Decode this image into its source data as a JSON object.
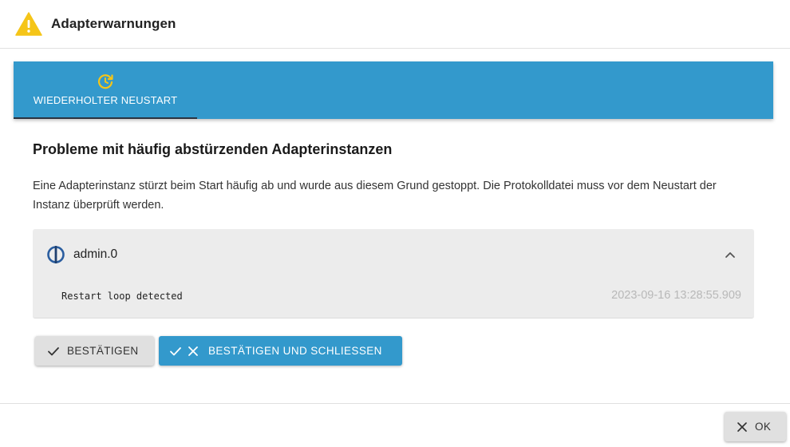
{
  "dialog": {
    "title": "Adapterwarnungen",
    "header_icon": "warning-triangle-icon",
    "accent_color": "#3399cc",
    "warning_color": "#f5c518"
  },
  "tabs": [
    {
      "label": "WIEDERHOLTER NEUSTART",
      "icon": "restart-clock-icon",
      "selected": true
    }
  ],
  "section": {
    "title": "Probleme mit häufig abstürzenden Adapterinstanzen",
    "description": "Eine Adapterinstanz stürzt beim Start häufig ab und wurde aus diesem Grund gestoppt. Die Protokolldatei muss vor dem Neustart der Instanz überprüft werden."
  },
  "instance": {
    "name": "admin.0",
    "icon": "iobroker-logo-icon",
    "expanded": true,
    "message": "Restart loop detected",
    "timestamp": "2023-09-16 13:28:55.909"
  },
  "actions": {
    "confirm_label": "BESTÄTIGEN",
    "confirm_close_label": "BESTÄTIGEN UND SCHLIESSEN"
  },
  "footer": {
    "ok_label": "OK"
  }
}
